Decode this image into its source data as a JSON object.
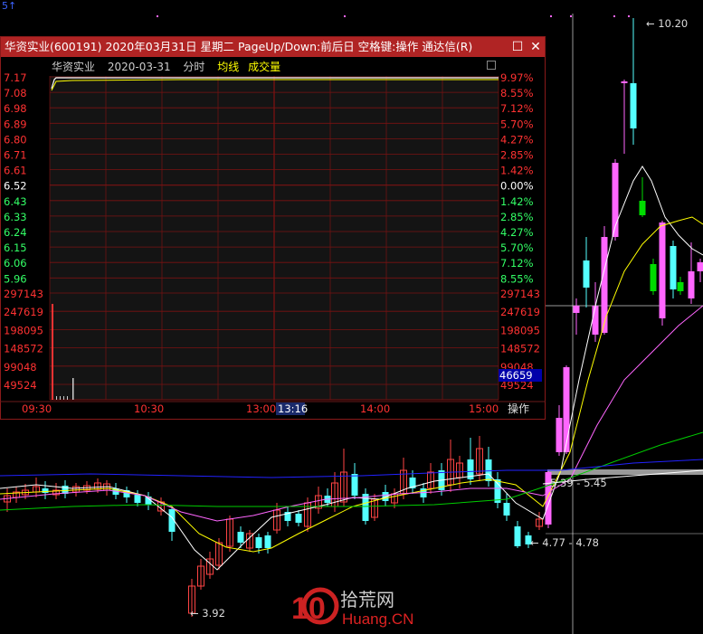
{
  "window": {
    "title": "华资实业(600191) 2020年03月31日 星期二 PageUp/Down:前后日 空格键:操作 通达信(R)",
    "maximize_icon": "square-icon",
    "close_icon": "close-icon"
  },
  "subheader": {
    "name": "华资实业",
    "date": "2020-03-31",
    "mode": "分时",
    "avg_label": "均线",
    "vol_label": "成交量"
  },
  "colors": {
    "up": "#ff3232",
    "down": "#54ffff",
    "flat": "#ffffff",
    "grid": "#7a1212",
    "price_line": "#ffffff",
    "avg_line": "#ffff00",
    "magenta": "#ff66ff",
    "green_bar": "#00dd00"
  },
  "price_axis_left": [
    "7.17",
    "7.08",
    "6.98",
    "6.89",
    "6.80",
    "6.71",
    "6.61",
    "6.52",
    "6.43",
    "6.33",
    "6.24",
    "6.15",
    "6.06",
    "5.96"
  ],
  "pct_axis_right": [
    "9.97%",
    "8.55%",
    "7.12%",
    "5.70%",
    "4.27%",
    "2.85%",
    "1.42%",
    "0.00%",
    "1.42%",
    "2.85%",
    "4.27%",
    "5.70%",
    "7.12%",
    "8.55%"
  ],
  "vol_axis_left": [
    "297143",
    "247619",
    "198095",
    "148572",
    "99048",
    "49524"
  ],
  "vol_axis_right": [
    "297143",
    "247619",
    "198095",
    "148572",
    "99048",
    "49524"
  ],
  "cursor_volume": "46659",
  "time_axis": [
    "09:30",
    "10:30",
    "13:00",
    "14:00",
    "15:00"
  ],
  "cursor_time": "13:16",
  "operate_label": "操作",
  "kline_annotations": {
    "high": "10.20",
    "low": "3.92",
    "range1": "5.39 - 5.45",
    "range2": "4.77 - 4.78"
  },
  "top_marker": "5↑",
  "watermark": {
    "main": "拾荒网",
    "sub": "Huang.CN",
    "num": "10"
  }
}
